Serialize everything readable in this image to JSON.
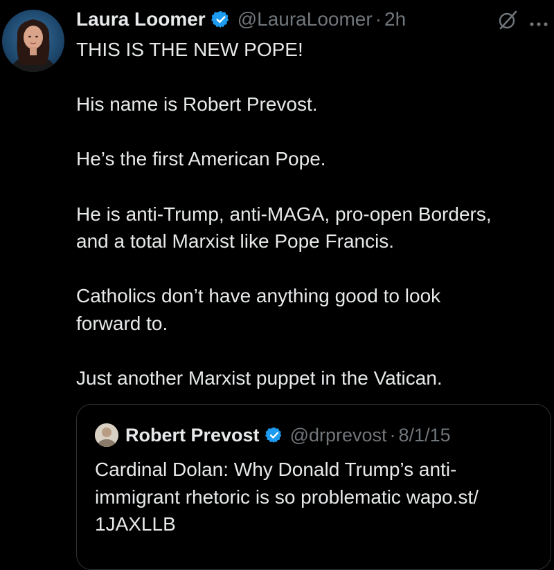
{
  "tweet": {
    "author": {
      "display_name": "Laura Loomer",
      "handle": "@LauraLoomer",
      "verified": true
    },
    "separator": "·",
    "timestamp": "2h",
    "body": "THIS IS THE NEW POPE!\n\nHis name is Robert Prevost.\n\nHe’s the first American Pope.\n\nHe is anti-Trump, anti-MAGA, pro-open Borders,\nand a total Marxist like Pope Francis.\n\nCatholics don’t have anything good to look\nforward to.\n\nJust another Marxist puppet in the Vatican.",
    "icons": {
      "grok": "grok-icon",
      "more": "more-icon",
      "verified": "verified-badge-icon"
    }
  },
  "quoted_tweet": {
    "author": {
      "display_name": "Robert Prevost",
      "handle": "@drprevost",
      "verified": true
    },
    "separator": "·",
    "timestamp": "8/1/15",
    "body": "Cardinal Dolan: Why Donald Trump’s anti-\nimmigrant rhetoric is so problematic wapo.st/\n1JAXLLB"
  },
  "colors": {
    "background": "#000000",
    "text_primary": "#e7e9ea",
    "text_secondary": "#71767b",
    "verified_blue": "#1d9bf0",
    "border": "#2f3336"
  }
}
